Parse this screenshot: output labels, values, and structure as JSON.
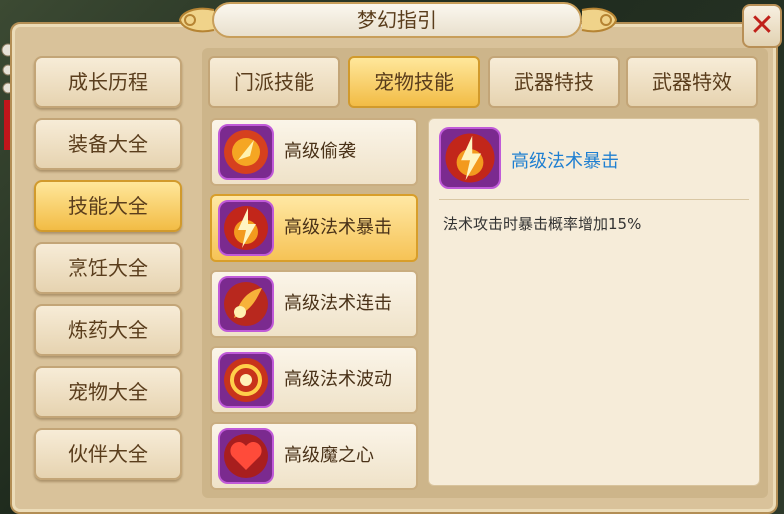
{
  "window": {
    "title": "梦幻指引",
    "close_label": "✕"
  },
  "sidebar": {
    "items": [
      {
        "label": "成长历程",
        "active": false
      },
      {
        "label": "装备大全",
        "active": false
      },
      {
        "label": "技能大全",
        "active": true
      },
      {
        "label": "烹饪大全",
        "active": false
      },
      {
        "label": "炼药大全",
        "active": false
      },
      {
        "label": "宠物大全",
        "active": false
      },
      {
        "label": "伙伴大全",
        "active": false
      }
    ]
  },
  "tabs": [
    {
      "label": "门派技能",
      "active": false
    },
    {
      "label": "宠物技能",
      "active": true
    },
    {
      "label": "武器特技",
      "active": false
    },
    {
      "label": "武器特效",
      "active": false
    }
  ],
  "skills": [
    {
      "name": "高级偷袭",
      "icon": "sneak-attack-icon",
      "active": false
    },
    {
      "name": "高级法术暴击",
      "icon": "spell-crit-icon",
      "active": true
    },
    {
      "name": "高级法术连击",
      "icon": "spell-combo-icon",
      "active": false
    },
    {
      "name": "高级法术波动",
      "icon": "spell-wave-icon",
      "active": false
    },
    {
      "name": "高级魔之心",
      "icon": "demon-heart-icon",
      "active": false
    }
  ],
  "detail": {
    "title": "高级法术暴击",
    "icon": "spell-crit-icon",
    "description": "法术攻击时暴击概率增加15%"
  },
  "colors": {
    "accent": "#f2bc45",
    "link": "#1f7fd1",
    "close": "#c0211a"
  }
}
